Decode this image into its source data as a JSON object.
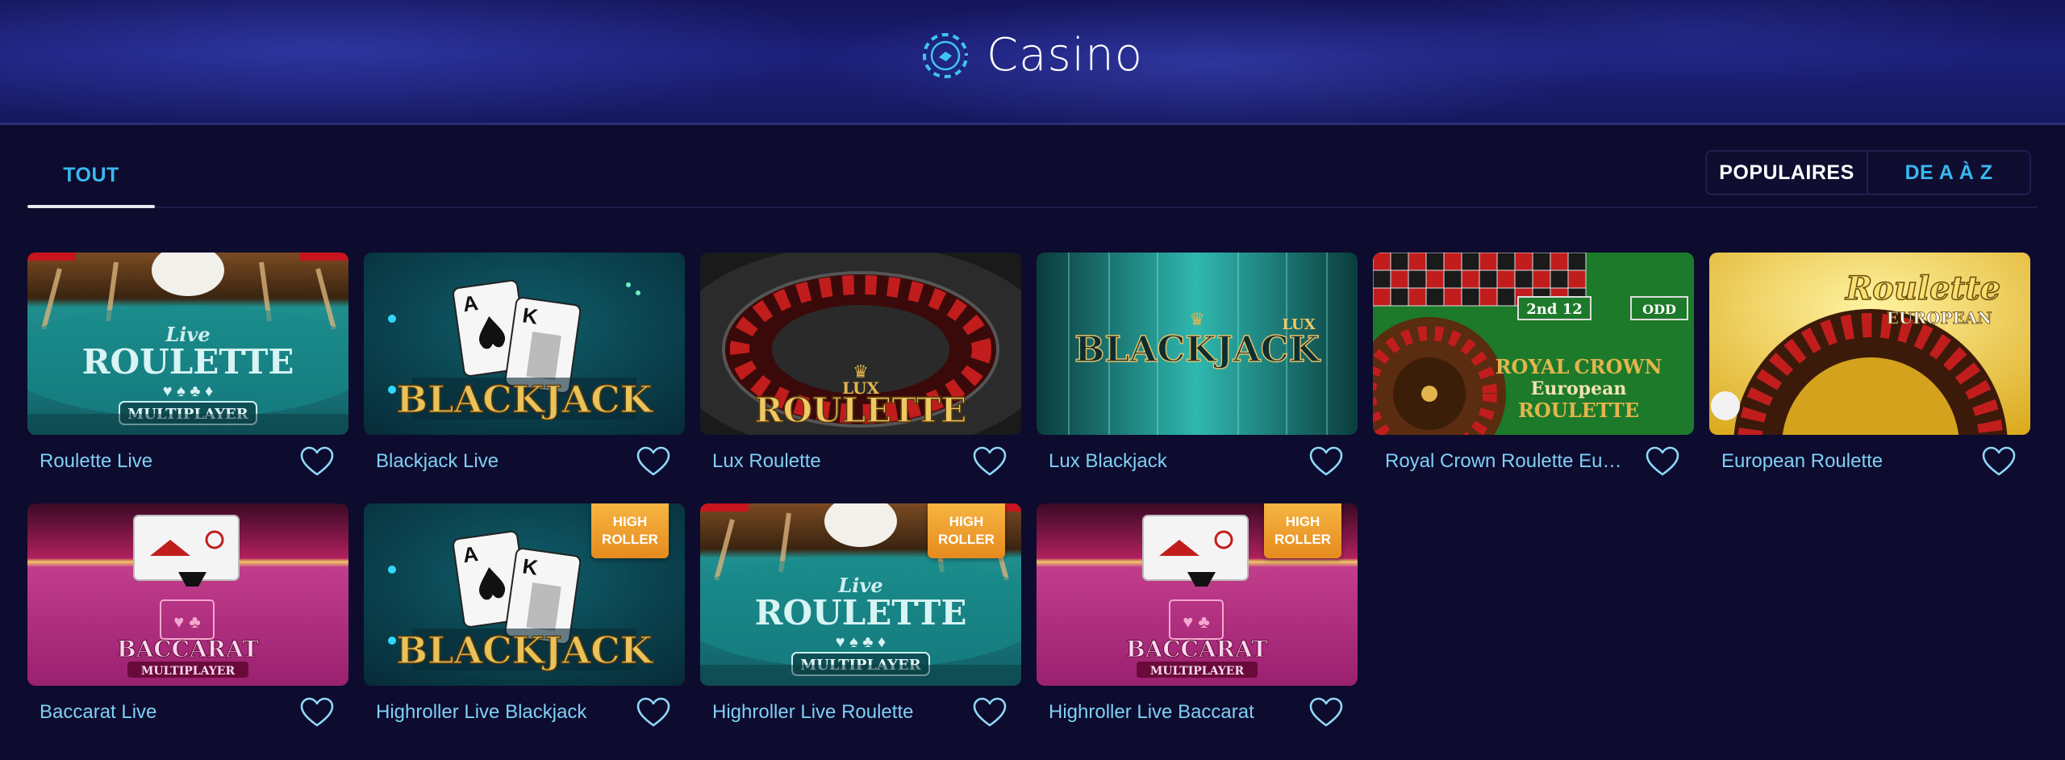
{
  "header": {
    "title": "Casino",
    "icon": "casino-chip-icon"
  },
  "tabs": [
    {
      "label": "TOUT",
      "active": true
    }
  ],
  "sort": {
    "populaires": "POPULAIRES",
    "az": "DE A À Z"
  },
  "colors": {
    "accent": "#38b8ef",
    "background": "#0d0b2e",
    "badge": "#f0a030"
  },
  "games": [
    {
      "name": "Roulette Live",
      "art": "live-roulette",
      "art_text": [
        "Live",
        "ROULETTE",
        "MULTIPLAYER"
      ],
      "badge": null
    },
    {
      "name": "Blackjack Live",
      "art": "blackjack",
      "art_text": [
        "BLACKJACK"
      ],
      "badge": null
    },
    {
      "name": "Lux Roulette",
      "art": "lux-roulette",
      "art_text": [
        "LUX",
        "ROULETTE"
      ],
      "badge": null
    },
    {
      "name": "Lux Blackjack",
      "art": "lux-blackjack",
      "art_text": [
        "LUX",
        "BLACKJACK"
      ],
      "badge": null
    },
    {
      "name": "Royal Crown Roulette Eu…",
      "art": "royal-crown",
      "art_text": [
        "ROYAL",
        "CROWN",
        "European",
        "ROULETTE",
        "2nd 12",
        "ODD"
      ],
      "badge": null
    },
    {
      "name": "European Roulette",
      "art": "european-roulette",
      "art_text": [
        "Roulette",
        "EUROPEAN"
      ],
      "badge": null
    },
    {
      "name": "Baccarat Live",
      "art": "baccarat",
      "art_text": [
        "BACCARAT",
        "MULTIPLAYER"
      ],
      "badge": null
    },
    {
      "name": "Highroller Live Blackjack",
      "art": "blackjack",
      "art_text": [
        "BLACKJACK"
      ],
      "badge": [
        "HIGH",
        "ROLLER"
      ]
    },
    {
      "name": "Highroller Live Roulette",
      "art": "live-roulette",
      "art_text": [
        "Live",
        "ROULETTE",
        "MULTIPLAYER"
      ],
      "badge": [
        "HIGH",
        "ROLLER"
      ]
    },
    {
      "name": "Highroller Live Baccarat",
      "art": "baccarat",
      "art_text": [
        "BACCARAT",
        "MULTIPLAYER"
      ],
      "badge": [
        "HIGH",
        "ROLLER"
      ]
    }
  ]
}
